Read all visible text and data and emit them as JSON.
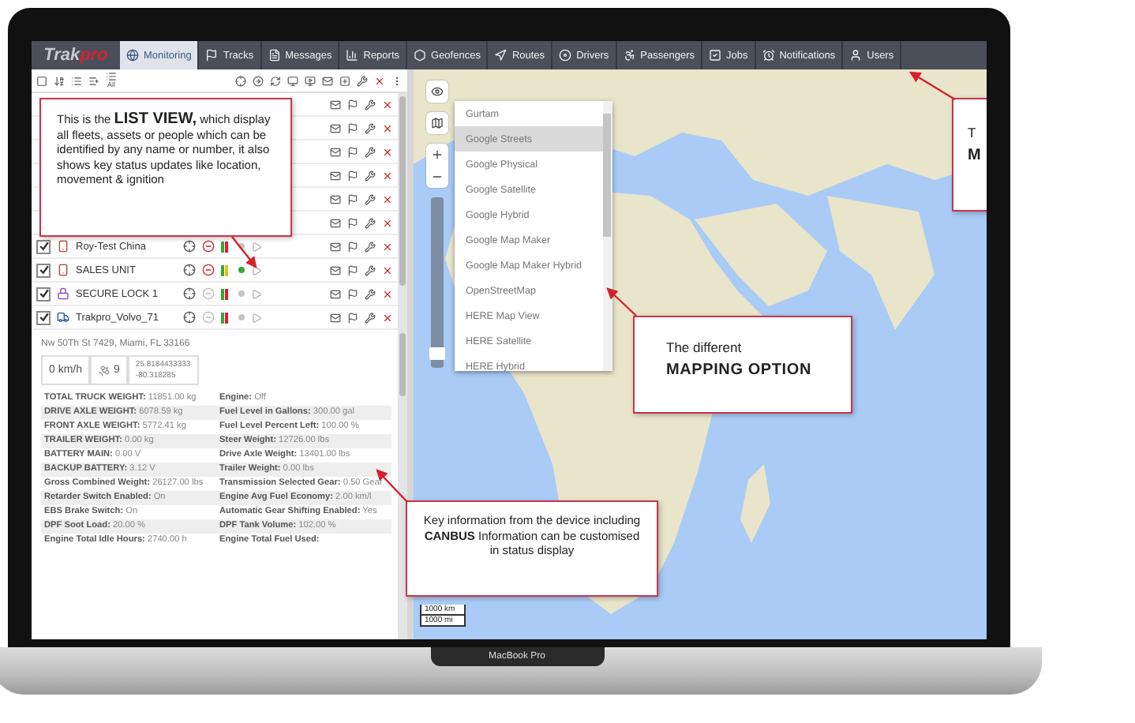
{
  "laptop": {
    "model": "MacBook Pro"
  },
  "nav": {
    "logo": "Trak",
    "logo_accent": "pro",
    "tabs": [
      {
        "label": "Monitoring",
        "selected": true
      },
      {
        "label": "Tracks",
        "selected": false
      },
      {
        "label": "Messages",
        "selected": false
      },
      {
        "label": "Reports",
        "selected": false
      },
      {
        "label": "Geofences",
        "selected": false
      },
      {
        "label": "Routes",
        "selected": false
      },
      {
        "label": "Drivers",
        "selected": false
      },
      {
        "label": "Passengers",
        "selected": false
      },
      {
        "label": "Jobs",
        "selected": false
      },
      {
        "label": "Notifications",
        "selected": false
      },
      {
        "label": "Users",
        "selected": false
      }
    ]
  },
  "list_toolbar": {
    "all_label": "All"
  },
  "units": [
    {
      "name": "Roy-Test China",
      "checked": true,
      "alert": true,
      "online": false
    },
    {
      "name": "SALES UNIT",
      "checked": true,
      "alert": true,
      "online": true
    },
    {
      "name": "SECURE LOCK 1",
      "checked": true,
      "alert": false,
      "online": false
    },
    {
      "name": "Trakpro_Volvo_71",
      "checked": true,
      "alert": false,
      "online": false
    }
  ],
  "details": {
    "address": "Nw 50Th St 7429, Miami, FL 33166",
    "speed": "0 km/h",
    "satellites": "9",
    "latitude": "25.8184433333",
    "longitude": "-80.318285",
    "rows": [
      [
        "**TOTAL TRUCK WEIGHT:** 11851.00 kg",
        "**Engine:** Off"
      ],
      [
        "**DRIVE AXLE WEIGHT:** 6078.59 kg",
        "**Fuel Level in Gallons:** 300.00 gal"
      ],
      [
        "**FRONT AXLE WEIGHT:** 5772.41 kg",
        "**Fuel Level Percent Left:** 100.00 %"
      ],
      [
        "**TRAILER WEIGHT:** 0.00 kg",
        "**Steer Weight:** 12726.00 lbs"
      ],
      [
        "**BATTERY MAIN:** 0.00 V",
        "**Drive Axle Weight:** 13401.00 lbs"
      ],
      [
        "**BACKUP BATTERY:** 3.12 V",
        "**Trailer Weight:** 0.00 lbs"
      ],
      [
        "**Gross Combined Weight:** 26127.00 lbs",
        "**Transmission Selected Gear:** 0.50 Gear"
      ],
      [
        "**Retarder Switch Enabled:** On",
        "**Engine Avg Fuel Economy:** 2.00 km/l"
      ],
      [
        "**EBS Brake Switch:** On",
        "**Automatic Gear Shifting Enabled:** Yes"
      ],
      [
        "**DPF Soot Load:** 20.00 %",
        "**DPF Tank Volume:** 102.00 %"
      ],
      [
        "**Engine Total Idle Hours:** 2740.00 h",
        "**Engine Total Fuel Used:**"
      ]
    ]
  },
  "map": {
    "zoom_slider": {
      "level": 0.05
    },
    "layers": [
      {
        "label": "Gurtam",
        "selected": false
      },
      {
        "label": "Google Streets",
        "selected": true
      },
      {
        "label": "Google Physical",
        "selected": false
      },
      {
        "label": "Google Satellite",
        "selected": false
      },
      {
        "label": "Google Hybrid",
        "selected": false
      },
      {
        "label": "Google Map Maker",
        "selected": false
      },
      {
        "label": "Google Map Maker Hybrid",
        "selected": false
      },
      {
        "label": "OpenStreetMap",
        "selected": false
      },
      {
        "label": "HERE Map View",
        "selected": false
      },
      {
        "label": "HERE Satellite",
        "selected": false
      },
      {
        "label": "HERE Hybrid",
        "selected": false
      }
    ],
    "scale": [
      "1000 km",
      "1000 mi"
    ]
  },
  "callouts": {
    "list_view": {
      "lead": "This is the",
      "title": "LIST VIEW,",
      "body": "which display all fleets, assets or people which can be identified by any name or number, it also shows key status updates like location, movement & ignition"
    },
    "mapping": {
      "lead": "The different",
      "title": "MAPPING OPTION"
    },
    "canbus": {
      "text": "Key information from the device including **CANBUS** Information can be customised in status display"
    },
    "cut_off": {
      "line_1": "T",
      "line_2": "M"
    }
  }
}
